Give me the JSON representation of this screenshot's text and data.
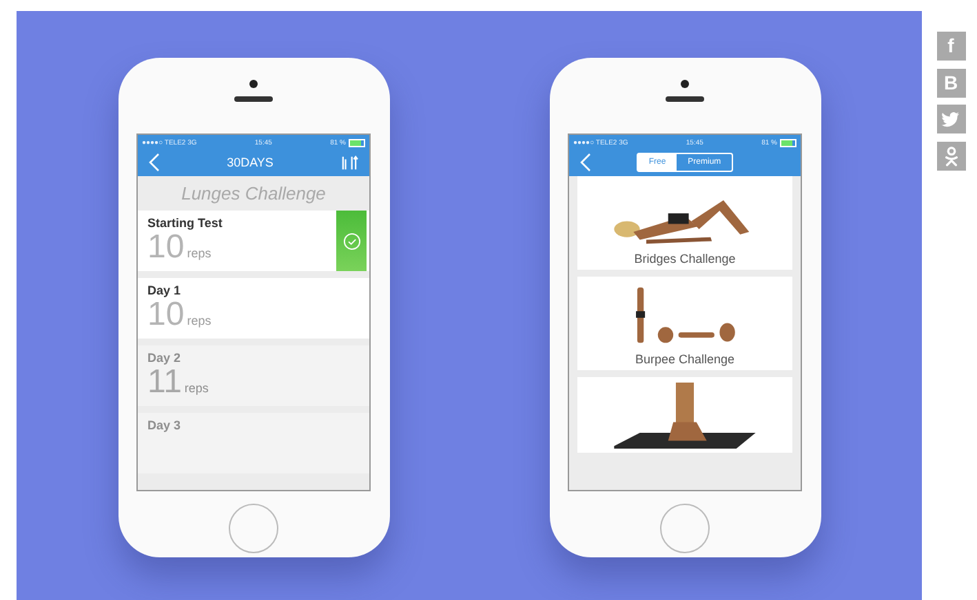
{
  "phones": [
    {
      "kind": "list",
      "status": {
        "carrier": "●●●●○ TELE2  3G",
        "time": "15:45",
        "battery": "81 %",
        "level": 0.81
      },
      "nav": {
        "title": "30DAYS"
      },
      "heading": "Lunges Challenge",
      "days": [
        {
          "name": "Starting Test",
          "count": "10",
          "unit": "reps",
          "completed": true,
          "locked": false
        },
        {
          "name": "Day 1",
          "count": "10",
          "unit": "reps",
          "completed": false,
          "locked": false
        },
        {
          "name": "Day 2",
          "count": "11",
          "unit": "reps",
          "completed": false,
          "locked": true
        },
        {
          "name": "Day 3",
          "completed": false,
          "locked": true
        }
      ]
    },
    {
      "kind": "gallery",
      "status": {
        "carrier": "●●●●○ TELE2  3G",
        "time": "15:45",
        "battery": "81 %",
        "level": 0.81
      },
      "segments": [
        {
          "label": "Free",
          "selected": true
        },
        {
          "label": "Premium",
          "selected": false
        }
      ],
      "cards": [
        {
          "label": "Bridges Challenge",
          "kind": "picture"
        },
        {
          "label": "Burpee Challenge",
          "kind": "picture"
        },
        {
          "kind": "picture"
        }
      ]
    }
  ],
  "share": [
    {
      "kind": "facebook",
      "label": "f"
    },
    {
      "kind": "vk",
      "label": "B"
    },
    {
      "kind": "twitter"
    },
    {
      "kind": "odnoklassniki"
    }
  ]
}
